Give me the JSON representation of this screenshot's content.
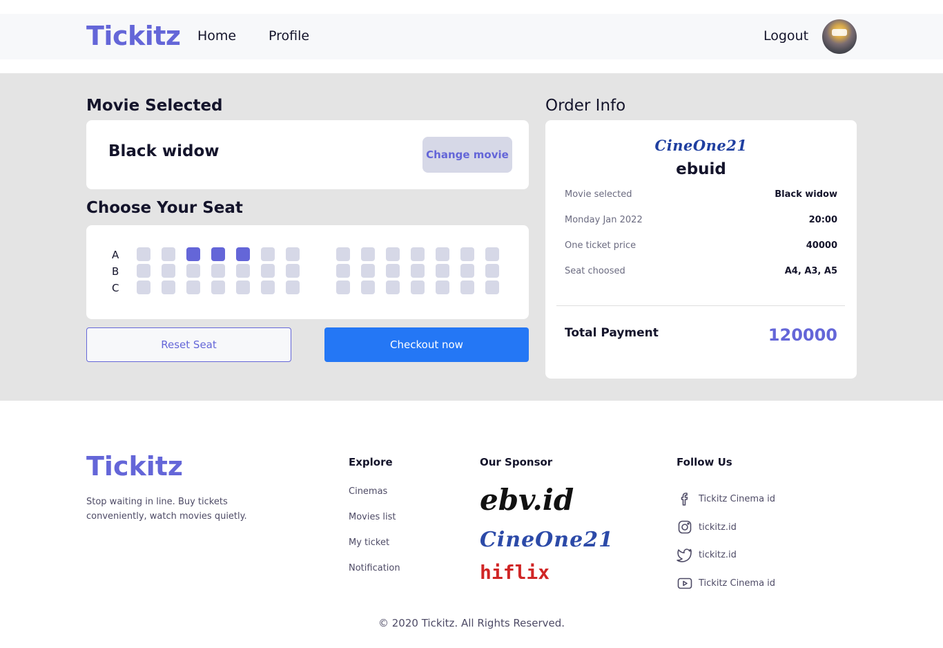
{
  "nav": {
    "brand": "Tickitz",
    "links": [
      "Home",
      "Profile"
    ],
    "logout": "Logout",
    "avatar": "user-avatar"
  },
  "movie_section": {
    "heading": "Movie Selected",
    "title": "Black widow",
    "change_button": "Change movie"
  },
  "seat_section": {
    "heading": "Choose Your Seat",
    "rows": [
      "A",
      "B",
      "C"
    ],
    "seats_per_row": 14,
    "selected": {
      "A": [
        3,
        4,
        5
      ]
    },
    "reset_button": "Reset Seat",
    "checkout_button": "Checkout now"
  },
  "order_info": {
    "heading": "Order Info",
    "cinema_logo": "CineOne21",
    "cinema_name": "ebuid",
    "rows": [
      {
        "label": "Movie selected",
        "value": "Black widow"
      },
      {
        "label": "Monday Jan 2022",
        "value": "20:00"
      },
      {
        "label": "One ticket price",
        "value": "40000"
      },
      {
        "label": "Seat choosed",
        "value": "A4, A3, A5"
      }
    ],
    "total_label": "Total Payment",
    "total_value": "120000"
  },
  "footer": {
    "brand": "Tickitz",
    "tagline": "Stop waiting in line. Buy tickets conveniently, watch movies quietly.",
    "explore_heading": "Explore",
    "explore_links": [
      "Cinemas",
      "Movies list",
      "My ticket",
      "Notification"
    ],
    "sponsor_heading": "Our Sponsor",
    "sponsors": [
      "ebv.id",
      "CineOne21",
      "hiflix"
    ],
    "follow_heading": "Follow Us",
    "socials": [
      {
        "icon": "facebook-icon",
        "label": "Tickitz Cinema id"
      },
      {
        "icon": "instagram-icon",
        "label": "tickitz.id"
      },
      {
        "icon": "twitter-icon",
        "label": "tickitz.id"
      },
      {
        "icon": "youtube-icon",
        "label": "Tickitz Cinema id"
      }
    ],
    "copyright": "© 2020 Tickitz. All Rights Reserved."
  },
  "colors": {
    "brand": "#6466d8",
    "seat_available": "#d6d8e7",
    "seat_selected": "#6466d8",
    "checkout": "#2477f5",
    "main_bg": "#e4e4e4"
  }
}
